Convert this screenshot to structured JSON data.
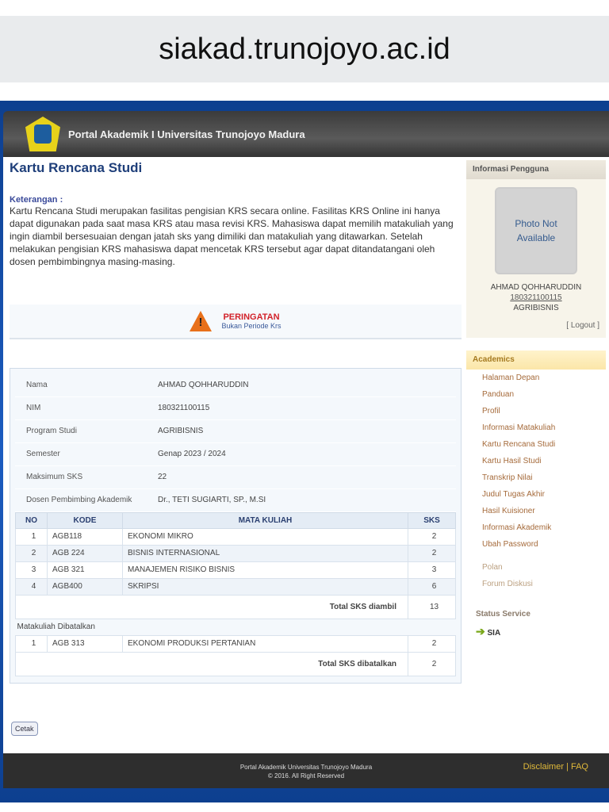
{
  "url": "siakad.trunojoyo.ac.id",
  "header": {
    "title": "Portal Akademik I Universitas Trunojoyo Madura"
  },
  "page": {
    "title": "Kartu Rencana Studi",
    "keterangan_label": "Keterangan :",
    "description": "Kartu Rencana Studi merupakan fasilitas pengisian KRS secara online. Fasilitas KRS Online ini hanya dapat digunakan pada saat masa KRS atau masa revisi KRS. Mahasiswa dapat memilih matakuliah yang ingin diambil bersesuaian dengan jatah sks yang dimiliki dan matakuliah yang ditawarkan. Setelah melakukan pengisian KRS mahasiswa dapat mencetak KRS tersebut agar dapat ditandatangani oleh dosen pembimbingnya masing-masing."
  },
  "warning": {
    "title": "PERINGATAN",
    "message": "Bukan Periode Krs"
  },
  "student": [
    {
      "label": "Nama",
      "value": "AHMAD QOHHARUDDIN"
    },
    {
      "label": "NIM",
      "value": "180321100115"
    },
    {
      "label": "Program Studi",
      "value": "AGRIBISNIS"
    },
    {
      "label": "Semester",
      "value": "Genap 2023 / 2024"
    },
    {
      "label": "Maksimum SKS",
      "value": "22"
    },
    {
      "label": "Dosen Pembimbing Akademik",
      "value": "Dr., TETI SUGIARTI, SP., M.SI"
    }
  ],
  "table": {
    "headers": [
      "NO",
      "KODE",
      "MATA KULIAH",
      "SKS"
    ],
    "rows": [
      [
        "1",
        "AGB118",
        "EKONOMI MIKRO",
        "2"
      ],
      [
        "2",
        "AGB 224",
        "BISNIS INTERNASIONAL",
        "2"
      ],
      [
        "3",
        "AGB 321",
        "MANAJEMEN RISIKO BISNIS",
        "3"
      ],
      [
        "4",
        "AGB400",
        "SKRIPSI",
        "6"
      ]
    ],
    "total_label": "Total SKS diambil",
    "total": "13",
    "cancelled_label": "Matakuliah Dibatalkan",
    "cancelled_rows": [
      [
        "1",
        "AGB 313",
        "EKONOMI PRODUKSI PERTANIAN",
        "2"
      ]
    ],
    "cancelled_total_label": "Total SKS dibatalkan",
    "cancelled_total": "2"
  },
  "cetak": "Cetak",
  "sidebar": {
    "user_header": "Informasi Pengguna",
    "photo": "Photo Not Available",
    "name": "AHMAD QOHHARUDDIN",
    "nim": "180321100115",
    "prodi": "AGRIBISNIS",
    "logout": "[ Logout ]",
    "academic_header": "Academics",
    "menu": [
      "Halaman Depan",
      "Panduan",
      "Profil",
      "Informasi Matakuliah",
      "Kartu Rencana Studi",
      "Kartu Hasil Studi",
      "Transkrip Nilai",
      "Judul Tugas Akhir",
      "Hasil Kuisioner",
      "Informasi Akademik",
      "Ubah Password"
    ],
    "menu2": [
      "Polan",
      "Forum Diskusi"
    ],
    "status_header": "Status Service",
    "service": "SIA"
  },
  "footer": {
    "line1": "Portal Akademik Universitas Trunojoyo Madura",
    "line2": "© 2016. All Right Reserved",
    "disclaimer": "Disclaimer",
    "faq": "FAQ"
  }
}
